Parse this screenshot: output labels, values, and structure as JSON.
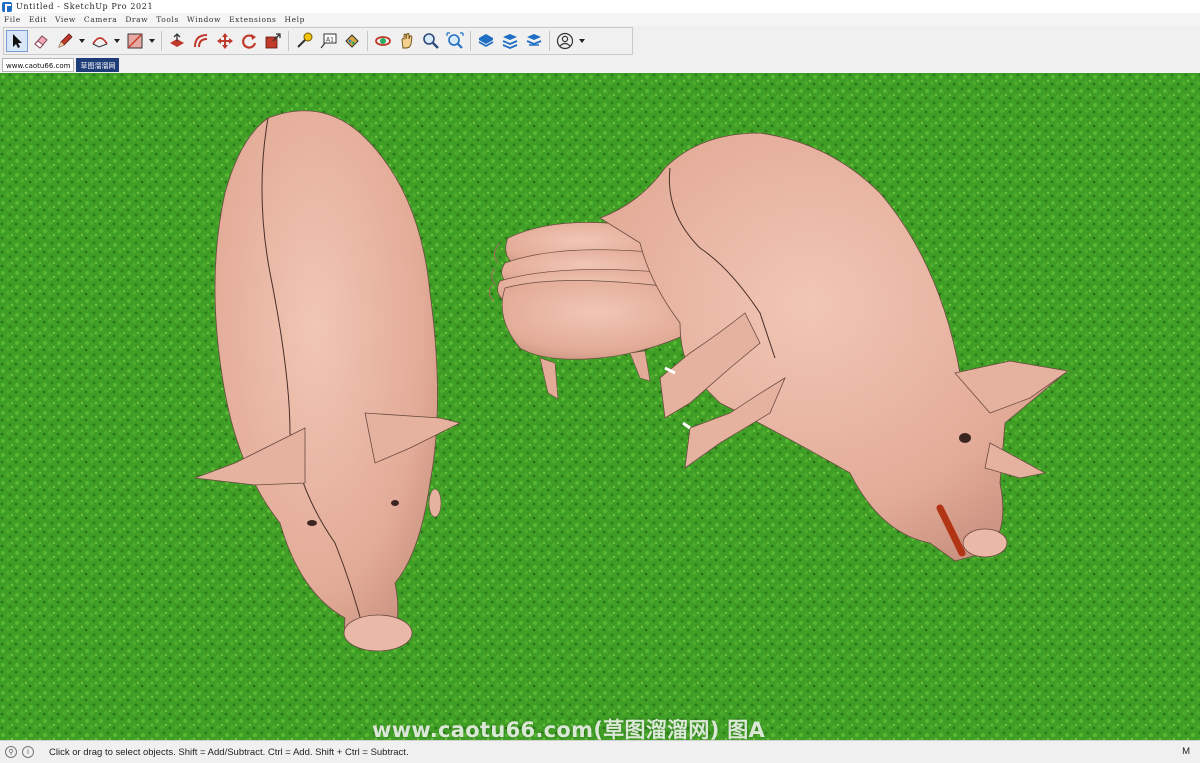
{
  "window": {
    "title": "Untitled - SketchUp Pro 2021"
  },
  "menu": [
    "File",
    "Edit",
    "View",
    "Camera",
    "Draw",
    "Tools",
    "Window",
    "Extensions",
    "Help"
  ],
  "toolbar": {
    "tools": [
      {
        "name": "select-tool",
        "icon": "arrow-cursor-icon",
        "selected": true
      },
      {
        "name": "eraser-tool",
        "icon": "eraser-icon"
      },
      {
        "name": "line-tool",
        "icon": "pencil-icon"
      },
      {
        "name": "arc-tool",
        "icon": "arc-icon"
      },
      {
        "name": "rectangle-tool",
        "icon": "rectangle-icon"
      },
      {
        "name": "push-pull-tool",
        "icon": "push-pull-icon"
      },
      {
        "name": "offset-tool",
        "icon": "offset-icon"
      },
      {
        "name": "move-tool",
        "icon": "move-icon"
      },
      {
        "name": "rotate-tool",
        "icon": "rotate-icon"
      },
      {
        "name": "scale-tool",
        "icon": "scale-icon"
      },
      {
        "name": "tape-measure-tool",
        "icon": "tape-measure-icon"
      },
      {
        "name": "text-tool",
        "icon": "text-icon"
      },
      {
        "name": "paint-bucket-tool",
        "icon": "paint-bucket-icon"
      },
      {
        "name": "orbit-tool",
        "icon": "orbit-icon"
      },
      {
        "name": "pan-tool",
        "icon": "hand-icon"
      },
      {
        "name": "zoom-tool",
        "icon": "magnifier-icon"
      },
      {
        "name": "zoom-extents-tool",
        "icon": "zoom-extents-icon"
      },
      {
        "name": "3d-warehouse-tool",
        "icon": "warehouse-icon"
      },
      {
        "name": "extension-warehouse-tool",
        "icon": "extension-icon"
      },
      {
        "name": "layout-tool",
        "icon": "layout-icon"
      },
      {
        "name": "account-tool",
        "icon": "account-icon"
      }
    ]
  },
  "scene_tabs": [
    {
      "label": "www.caotu66.com",
      "active": false
    },
    {
      "label": "草图溜溜网",
      "active": true
    }
  ],
  "viewport": {
    "watermark": "www.caotu66.com(草图溜溜网) 图A",
    "ground_color": "#3f9e26",
    "pig_color": "#e8b3a0"
  },
  "status": {
    "message": "Click or drag to select objects. Shift = Add/Subtract. Ctrl = Add. Shift + Ctrl = Subtract.",
    "measurement_label": "M"
  }
}
